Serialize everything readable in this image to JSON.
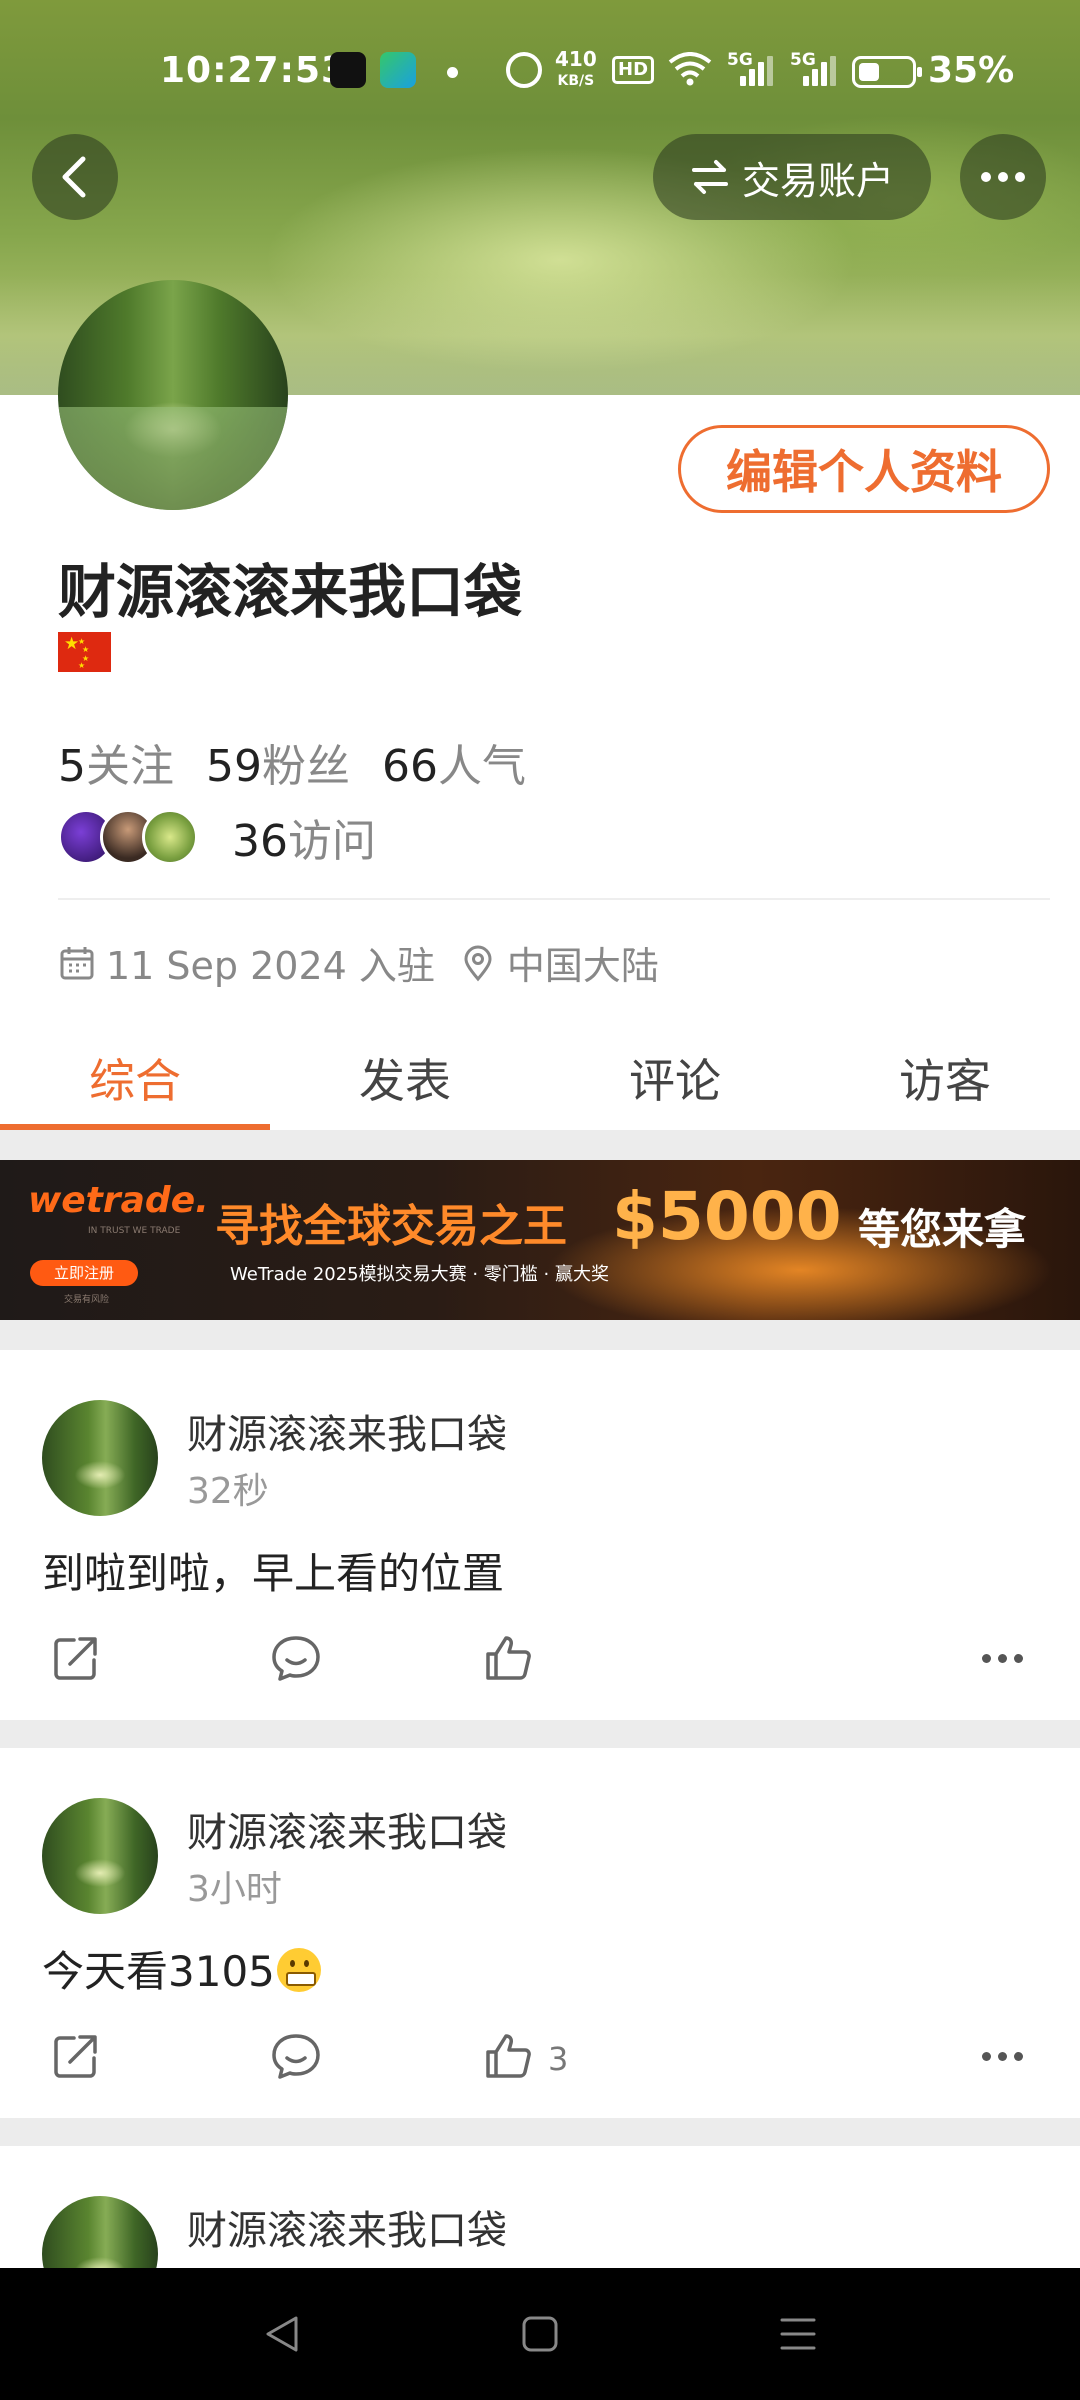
{
  "status_bar": {
    "time": "10:27:53",
    "net_speed_value": "410",
    "net_speed_unit": "KB/S",
    "hd_label": "HD",
    "sig1_label": "5G",
    "sig2_label": "5G",
    "battery_pct": "35%"
  },
  "header": {
    "account_button_label": "交易账户"
  },
  "profile": {
    "edit_button_label": "编辑个人资料",
    "name": "财源滚滚来我口袋",
    "stats": [
      {
        "num": "5",
        "label": "关注"
      },
      {
        "num": "59",
        "label": "粉丝"
      },
      {
        "num": "66",
        "label": "人气"
      }
    ],
    "visits_num": "36",
    "visits_label": "访问",
    "join_date": "11 Sep 2024 入驻",
    "location": "中国大陆"
  },
  "tabs": [
    {
      "label": "综合",
      "active": true
    },
    {
      "label": "发表",
      "active": false
    },
    {
      "label": "评论",
      "active": false
    },
    {
      "label": "访客",
      "active": false
    }
  ],
  "banner": {
    "logo": "wetrade.",
    "slogan": "IN TRUST WE TRADE",
    "register_label": "立即注册",
    "risk": "交易有风险",
    "headline": "寻找全球交易之王",
    "amount": "$5000",
    "tagline": "等您来拿",
    "sub": "WeTrade 2025模拟交易大赛 · 零门槛 · 赢大奖"
  },
  "posts": [
    {
      "author": "财源滚滚来我口袋",
      "time": "32秒",
      "text": "到啦到啦，早上看的位置",
      "likes": ""
    },
    {
      "author": "财源滚滚来我口袋",
      "time": "3小时",
      "text": "今天看3105",
      "likes": "3"
    },
    {
      "author": "财源滚滚来我口袋",
      "time": "",
      "text": "",
      "likes": ""
    }
  ],
  "colors": {
    "accent": "#ee6d30",
    "flag_red": "#de2910"
  }
}
